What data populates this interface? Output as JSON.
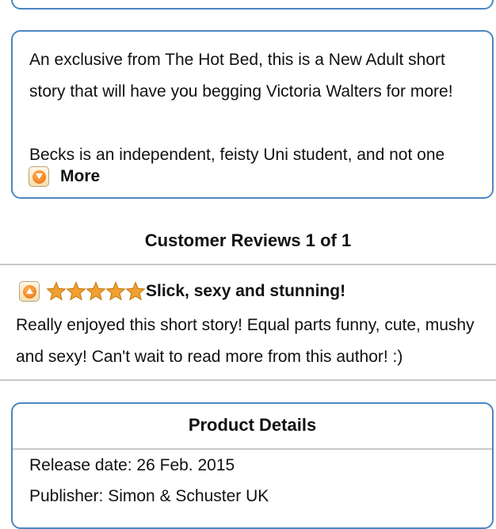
{
  "description": {
    "paragraph_1": "An exclusive from The Hot Bed, this is a New Adult short story that will have you begging Victoria Walters for more!",
    "paragraph_2": "Becks is an independent, feisty Uni student, and not one",
    "more_label": "More"
  },
  "reviews": {
    "heading": "Customer Reviews 1 of 1",
    "items": [
      {
        "rating": 5,
        "title": "Slick, sexy and stunning!",
        "body": "Really enjoyed this short story! Equal parts funny, cute, mushy and sexy! Can't wait to read more from this author! :)"
      }
    ]
  },
  "product_details": {
    "title": "Product Details",
    "release_date": "Release date: 26 Feb. 2015",
    "publisher": "Publisher: Simon & Schuster UK"
  },
  "colors": {
    "box_border": "#4a86c0",
    "star": "#f0a030",
    "toggle_accent": "#e8690c"
  },
  "icons": {
    "expand": "chevron-down-icon",
    "collapse": "chevron-up-icon",
    "star": "star-icon"
  }
}
